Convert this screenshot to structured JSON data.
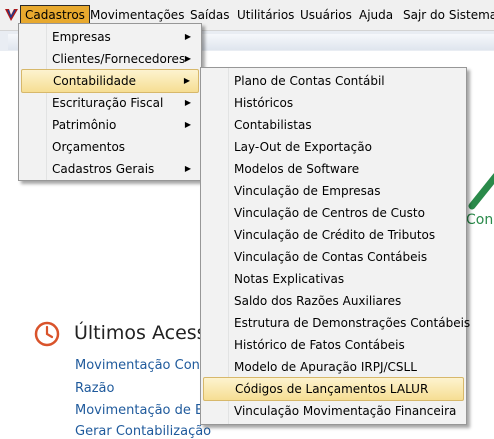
{
  "menubar": {
    "items": [
      "Cadastros",
      "Movimentações",
      "Saídas",
      "Utilitários",
      "Usuários",
      "Ajuda",
      "Sajr do Sistema"
    ]
  },
  "cadastros_menu": {
    "items": [
      {
        "label": "Empresas",
        "submenu": true
      },
      {
        "label": "Clientes/Fornecedores",
        "submenu": true
      },
      {
        "label": "Contabilidade",
        "submenu": true
      },
      {
        "label": "Escrituração Fiscal",
        "submenu": true
      },
      {
        "label": "Patrimônio",
        "submenu": true
      },
      {
        "label": "Orçamentos",
        "submenu": false
      },
      {
        "label": "Cadastros Gerais",
        "submenu": true
      }
    ],
    "highlighted": "Contabilidade"
  },
  "contabilidade_menu": {
    "items": [
      "Plano de Contas Contábil",
      "Históricos",
      "Contabilistas",
      "Lay-Out de Exportação",
      "Modelos de Software",
      "Vinculação de Empresas",
      "Vinculação de Centros de Custo",
      "Vinculação de Crédito de Tributos",
      "Vinculação de Contas Contábeis",
      "Notas Explicativas",
      "Saldo dos Razões Auxiliares",
      "Estrutura de Demonstrações Contábeis",
      "Histórico de Fatos Contábeis",
      "Modelo de Apuração IRPJ/CSLL",
      "Códigos de Lançamentos LALUR",
      "Vinculação Movimentação Financeira"
    ],
    "highlighted": "Códigos de Lançamentos LALUR"
  },
  "background": {
    "partial_word": "Con",
    "recent_title": "Últimos Acesso",
    "recent_links": [
      "Movimentação Contáb",
      "Razão",
      "Movimentação de Ber",
      "Gerar Contabilização"
    ]
  },
  "colors": {
    "menu_active": "#e8a92e",
    "highlight": "#f6de93",
    "link": "#1f5a9c",
    "clock": "#d9532b"
  }
}
